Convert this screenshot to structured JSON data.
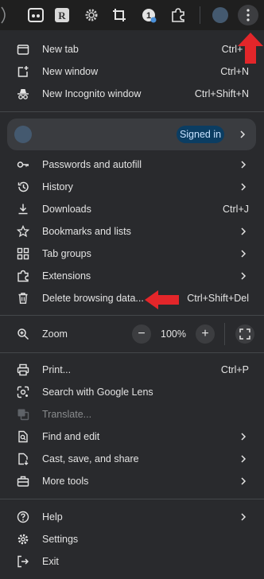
{
  "menu": {
    "items": {
      "new_tab": {
        "label": "New tab",
        "shortcut": "Ctrl+T"
      },
      "new_window": {
        "label": "New window",
        "shortcut": "Ctrl+N"
      },
      "new_incognito": {
        "label": "New Incognito window",
        "shortcut": "Ctrl+Shift+N"
      },
      "passwords": {
        "label": "Passwords and autofill"
      },
      "history": {
        "label": "History"
      },
      "downloads": {
        "label": "Downloads",
        "shortcut": "Ctrl+J"
      },
      "bookmarks": {
        "label": "Bookmarks and lists"
      },
      "tab_groups": {
        "label": "Tab groups"
      },
      "extensions": {
        "label": "Extensions"
      },
      "delete_browsing": {
        "label": "Delete browsing data...",
        "shortcut": "Ctrl+Shift+Del"
      },
      "zoom": {
        "label": "Zoom",
        "value": "100%",
        "minus": "−",
        "plus": "+"
      },
      "print": {
        "label": "Print...",
        "shortcut": "Ctrl+P"
      },
      "lens": {
        "label": "Search with Google Lens"
      },
      "translate": {
        "label": "Translate..."
      },
      "find_edit": {
        "label": "Find and edit"
      },
      "cast_save": {
        "label": "Cast, save, and share"
      },
      "more_tools": {
        "label": "More tools"
      },
      "help": {
        "label": "Help"
      },
      "settings": {
        "label": "Settings"
      },
      "exit": {
        "label": "Exit"
      }
    },
    "profile": {
      "status": "Signed in"
    }
  },
  "toolbar": {
    "icons": [
      "reader-mode-icon",
      "extension-r-icon",
      "gear-extension-icon",
      "crop-icon",
      "password-extension-icon",
      "puzzle-extensions-icon",
      "profile-avatar",
      "kebab-menu-icon"
    ]
  },
  "colors": {
    "menu_bg": "#292a2d",
    "toolbar_bg": "#1f1f1f",
    "signed_in_pill": "#0b3d62",
    "annotation_arrow": "#e3262a"
  }
}
